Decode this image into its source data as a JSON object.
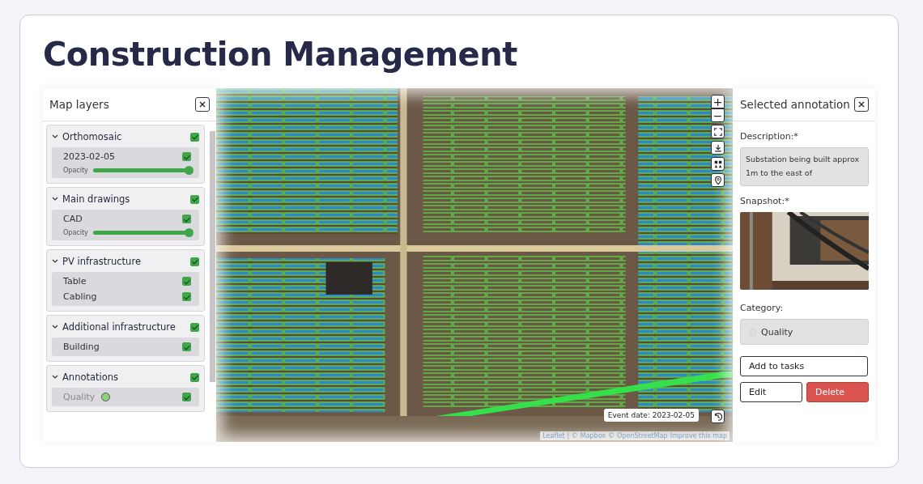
{
  "title": "Construction Management",
  "layers_panel": {
    "title": "Map layers",
    "groups": [
      {
        "name": "Orthomosaic",
        "expanded": true,
        "checked": true,
        "items": [
          {
            "kind": "slider",
            "name": "2023-02-05",
            "checked": true,
            "slider_label": "Opacity",
            "level": 1
          }
        ]
      },
      {
        "name": "Main drawings",
        "expanded": true,
        "checked": true,
        "items": [
          {
            "kind": "slider",
            "name": "CAD",
            "checked": true,
            "slider_label": "Opacity",
            "level": 1
          }
        ]
      },
      {
        "name": "PV infrastructure",
        "expanded": true,
        "checked": true,
        "items": [
          {
            "kind": "plain",
            "name": "Table",
            "checked": true
          },
          {
            "kind": "plain",
            "name": "Cabling",
            "checked": true
          }
        ]
      },
      {
        "name": "Additional infrastructure",
        "expanded": true,
        "checked": true,
        "items": [
          {
            "kind": "plain",
            "name": "Building",
            "checked": true
          }
        ]
      },
      {
        "name": "Annotations",
        "expanded": true,
        "checked": true,
        "items": [
          {
            "kind": "category",
            "name": "Quality",
            "checked": true,
            "color": "#8fd17a"
          }
        ]
      }
    ]
  },
  "map": {
    "controls": [
      {
        "kind": "zoom-in",
        "label": "+"
      },
      {
        "kind": "zoom-out",
        "label": "−"
      },
      {
        "kind": "fullscreen"
      },
      {
        "kind": "download"
      },
      {
        "kind": "layers"
      },
      {
        "kind": "pin"
      }
    ],
    "event_date": "Event date: 2023-02-05",
    "attribution": [
      {
        "kind": "link",
        "text": "Leaflet"
      },
      {
        "kind": "text",
        "text": "| ©"
      },
      {
        "kind": "link",
        "text": "Mapbox"
      },
      {
        "kind": "text",
        "text": "©"
      },
      {
        "kind": "link",
        "text": "OpenStreetMap"
      },
      {
        "kind": "link",
        "text": "Improve this map"
      }
    ]
  },
  "annotation_panel": {
    "title": "Selected annotation",
    "description_label": "Description:*",
    "description": "Substation being built approx 1m to the east of",
    "snapshot_label": "Snapshot:*",
    "category_label": "Category:",
    "category": {
      "label": "Quality",
      "disabled": true
    },
    "buttons": [
      {
        "kind": "outline",
        "label": "Add to tasks"
      },
      {
        "kind": "outline",
        "label": "Edit"
      },
      {
        "kind": "danger",
        "label": "Delete"
      }
    ]
  }
}
